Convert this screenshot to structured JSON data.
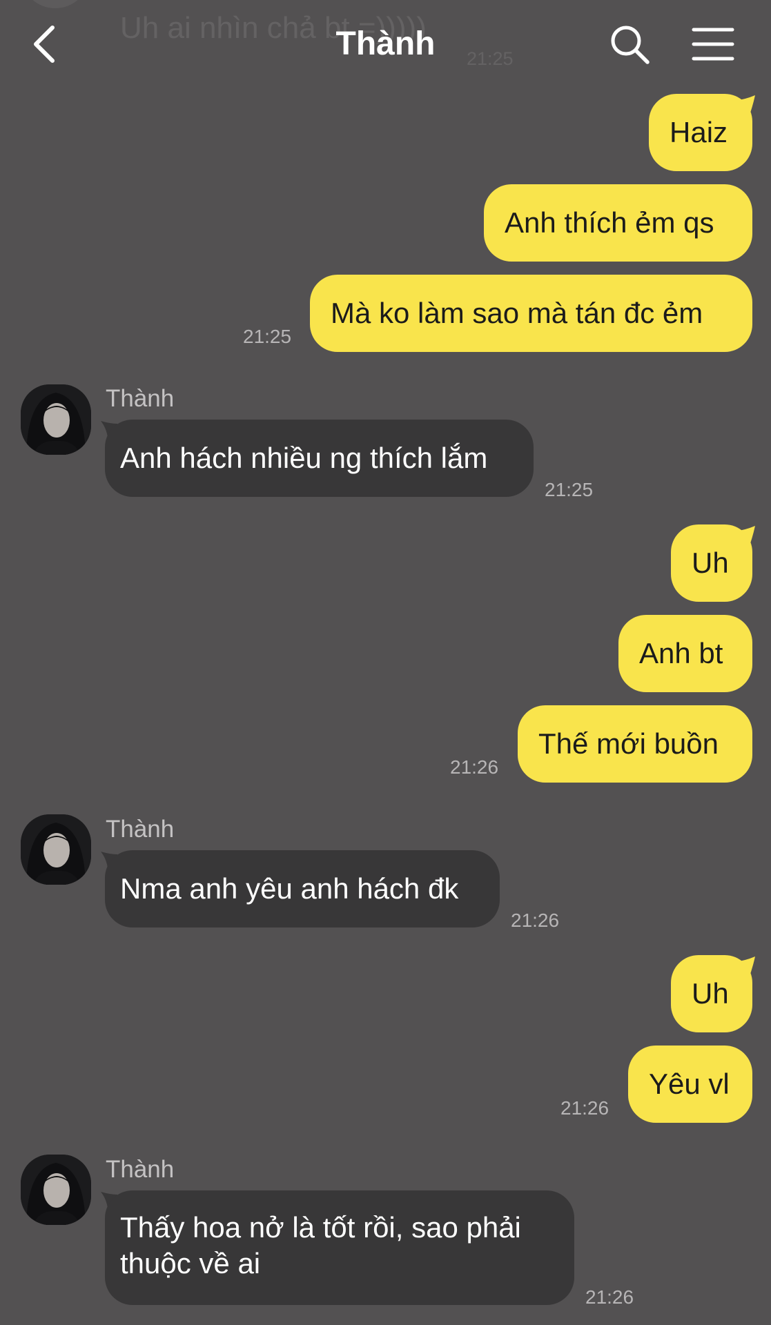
{
  "header": {
    "title": "Thành",
    "prev_message_text": "Uh ai nhìn chả bt =)))))",
    "prev_message_time": "21:25"
  },
  "icons": {
    "back": "chevron-left-icon",
    "search": "search-icon",
    "menu": "hamburger-menu-icon"
  },
  "colors": {
    "background": "#535152",
    "outgoing_bubble": "#f9e44c",
    "incoming_bubble": "#383738"
  },
  "messages": {
    "m1": {
      "text": "Haiz"
    },
    "m2": {
      "text": "Anh thích ẻm qs"
    },
    "m3": {
      "text": "Mà ko làm sao mà tán đc ẻm",
      "time": "21:25"
    },
    "m4": {
      "sender": "Thành",
      "text": "Anh hách nhiều ng thích lắm",
      "time": "21:25"
    },
    "m5": {
      "text": "Uh"
    },
    "m6": {
      "text": "Anh bt"
    },
    "m7": {
      "text": "Thế mới buồn",
      "time": "21:26"
    },
    "m8": {
      "sender": "Thành",
      "text": "Nma anh yêu anh hách đk",
      "time": "21:26"
    },
    "m9": {
      "text": "Uh"
    },
    "m10": {
      "text": "Yêu vl",
      "time": "21:26"
    },
    "m11": {
      "sender": "Thành",
      "text": "Thấy hoa nở là tốt rồi, sao phải thuộc về ai",
      "time": "21:26"
    }
  }
}
